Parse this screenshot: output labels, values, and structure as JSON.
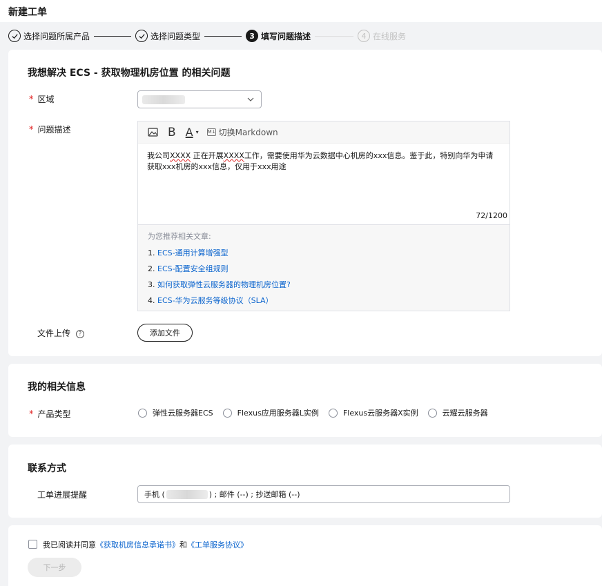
{
  "page": {
    "title": "新建工单"
  },
  "steps": [
    {
      "label": "选择问题所属产品",
      "num": "",
      "state": "done"
    },
    {
      "label": "选择问题类型",
      "num": "",
      "state": "done"
    },
    {
      "label": "填写问题描述",
      "num": "3",
      "state": "active"
    },
    {
      "label": "在线服务",
      "num": "4",
      "state": "pending"
    }
  ],
  "problem": {
    "title": "我想解决 ECS - 获取物理机房位置 的相关问题",
    "region_label": "区域",
    "desc_label": "问题描述",
    "toolbar": {
      "markdown_label": "切换Markdown",
      "bold": "B",
      "color": "A"
    },
    "text_a": "我公司",
    "text_b": "XXXX",
    "text_c": " 正在开展",
    "text_d": "XXXX",
    "text_e": "工作，需要使用华为云数据中心机房的xxx信息。鉴于此，特别向华为申请获取xxx机房的xxx信息，仅用于xxx用途",
    "counter": "72/1200",
    "recommend_title": "为您推荐相关文章:",
    "recommend": [
      {
        "num": "1.",
        "text": "ECS-通用计算增强型"
      },
      {
        "num": "2.",
        "text": "ECS-配置安全组规则"
      },
      {
        "num": "3.",
        "text": "如何获取弹性云服务器的物理机房位置?"
      },
      {
        "num": "4.",
        "text": "ECS-华为云服务等级协议（SLA）"
      }
    ],
    "upload_label": "文件上传",
    "help": "?",
    "add_file": "添加文件"
  },
  "info": {
    "title": "我的相关信息",
    "product_label": "产品类型",
    "options": [
      "弹性云服务器ECS",
      "Flexus应用服务器L实例",
      "Flexus云服务器X实例",
      "云耀云服务器"
    ]
  },
  "contact": {
    "title": "联系方式",
    "progress_label": "工单进展提醒",
    "phone_prefix": "手机 (",
    "phone_suffix": ") ; 邮件 (--) ; 抄送邮箱 (--)"
  },
  "footer": {
    "agree_text": "我已阅读并同意",
    "link1": "《获取机房信息承诺书》",
    "and": "和",
    "link2": "《工单服务协议》",
    "next": "下一步"
  },
  "colors": {
    "link": "#0c65ce",
    "required": "#e02020",
    "text": "#191919"
  },
  "req_mark": "*"
}
